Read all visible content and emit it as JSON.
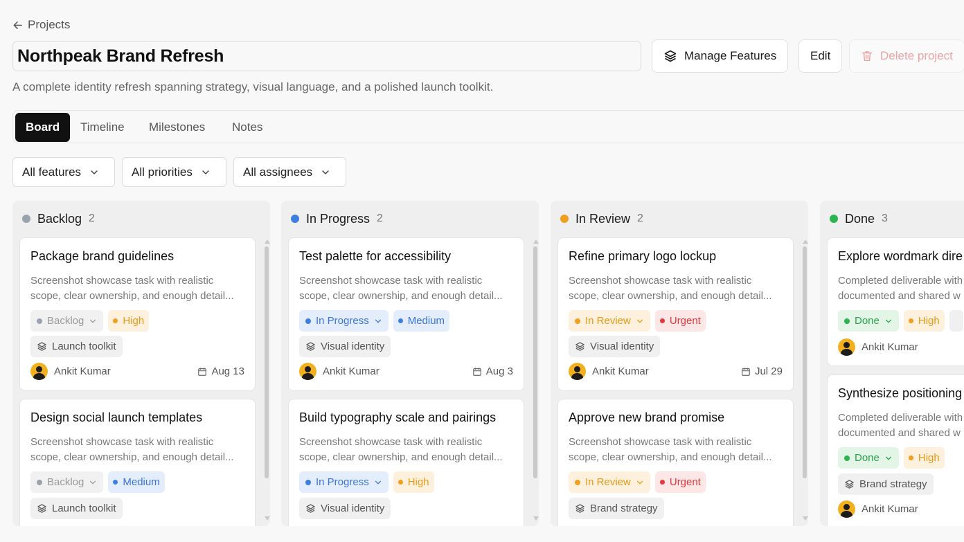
{
  "header": {
    "back_label": "Projects",
    "project_title": "Northpeak Brand Refresh",
    "manage_features_label": "Manage Features",
    "edit_label": "Edit",
    "delete_label": "Delete project",
    "description": "A complete identity refresh spanning strategy, visual language, and a polished launch toolkit."
  },
  "tabs": [
    {
      "label": "Board",
      "active": true
    },
    {
      "label": "Timeline",
      "active": false
    },
    {
      "label": "Milestones",
      "active": false
    },
    {
      "label": "Notes",
      "active": false
    }
  ],
  "filters": [
    {
      "label": "All features"
    },
    {
      "label": "All priorities"
    },
    {
      "label": "All assignees"
    }
  ],
  "colors": {
    "backlog": "#9aa3ad",
    "in_progress": "#3d7fe0",
    "in_review": "#f0a020",
    "done": "#2fb350",
    "delete": "#eba3a3"
  },
  "columns": [
    {
      "title": "Backlog",
      "count": "2",
      "cards": [
        {
          "title": "Package brand guidelines",
          "desc_line1": "Screenshot showcase task with realistic",
          "desc_line2": "scope, clear ownership, and enough detail...",
          "status": "Backlog",
          "priority": "High",
          "feature": "Launch toolkit",
          "assignee": "Ankit Kumar",
          "due": "Aug 13"
        },
        {
          "title": "Design social launch templates",
          "desc_line1": "Screenshot showcase task with realistic",
          "desc_line2": "scope, clear ownership, and enough detail...",
          "status": "Backlog",
          "priority": "Medium",
          "feature": "Launch toolkit",
          "assignee": "",
          "due": ""
        }
      ]
    },
    {
      "title": "In Progress",
      "count": "2",
      "cards": [
        {
          "title": "Test palette for accessibility",
          "desc_line1": "Screenshot showcase task with realistic",
          "desc_line2": "scope, clear ownership, and enough detail...",
          "status": "In Progress",
          "priority": "Medium",
          "feature": "Visual identity",
          "assignee": "Ankit Kumar",
          "due": "Aug 3"
        },
        {
          "title": "Build typography scale and pairings",
          "desc_line1": "Screenshot showcase task with realistic",
          "desc_line2": "scope, clear ownership, and enough detail...",
          "status": "In Progress",
          "priority": "High",
          "feature": "Visual identity",
          "assignee": "",
          "due": ""
        }
      ]
    },
    {
      "title": "In Review",
      "count": "2",
      "cards": [
        {
          "title": "Refine primary logo lockup",
          "desc_line1": "Screenshot showcase task with realistic",
          "desc_line2": "scope, clear ownership, and enough detail...",
          "status": "In Review",
          "priority": "Urgent",
          "feature": "Visual identity",
          "assignee": "Ankit Kumar",
          "due": "Jul 29"
        },
        {
          "title": "Approve new brand promise",
          "desc_line1": "Screenshot showcase task with realistic",
          "desc_line2": "scope, clear ownership, and enough detail...",
          "status": "In Review",
          "priority": "Urgent",
          "feature": "Brand strategy",
          "assignee": "",
          "due": ""
        }
      ]
    },
    {
      "title": "Done",
      "count": "3",
      "cards": [
        {
          "title": "Explore wordmark dire",
          "desc_line1": "Completed deliverable with",
          "desc_line2": "documented and shared w",
          "status": "Done",
          "priority": "High",
          "feature": "",
          "assignee": "Ankit Kumar",
          "due": ""
        },
        {
          "title": "Synthesize positioning",
          "desc_line1": "Completed deliverable with",
          "desc_line2": "documented and shared w",
          "status": "Done",
          "priority": "High",
          "feature": "Brand strategy",
          "assignee": "Ankit Kumar",
          "due": ""
        }
      ]
    }
  ]
}
